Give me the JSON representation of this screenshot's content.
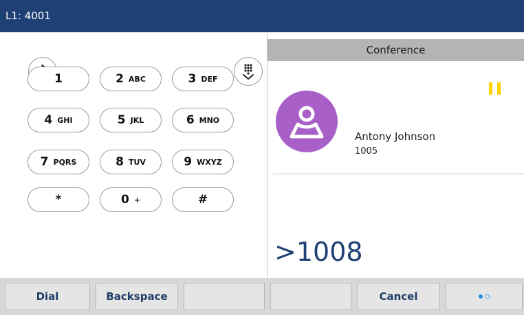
{
  "topbar": {
    "line_label": "L1: 4001"
  },
  "icons": {
    "bluetooth": "bluetooth-icon",
    "dialpad": "dialpad-icon",
    "avatar": "person-icon",
    "hold": "hold-indicator-icon"
  },
  "keypad": {
    "keys": [
      {
        "digit": "1",
        "letters": ""
      },
      {
        "digit": "2",
        "letters": "ABC"
      },
      {
        "digit": "3",
        "letters": "DEF"
      },
      {
        "digit": "4",
        "letters": "GHI"
      },
      {
        "digit": "5",
        "letters": "JKL"
      },
      {
        "digit": "6",
        "letters": "MNO"
      },
      {
        "digit": "7",
        "letters": "PQRS"
      },
      {
        "digit": "8",
        "letters": "TUV"
      },
      {
        "digit": "9",
        "letters": "WXYZ"
      },
      {
        "digit": "*",
        "letters": ""
      },
      {
        "digit": "0",
        "letters": "+"
      },
      {
        "digit": "#",
        "letters": ""
      }
    ]
  },
  "call": {
    "header": "Conference",
    "contact_name": "Antony Johnson",
    "contact_number": "1005",
    "dialed_number": ">1008"
  },
  "softkeys": [
    {
      "label": "Dial"
    },
    {
      "label": "Backspace"
    },
    {
      "label": ""
    },
    {
      "label": ""
    },
    {
      "label": "Cancel"
    }
  ],
  "pager": {
    "pages": 2,
    "current": 1
  },
  "colors": {
    "header_blue": "#1f4074",
    "avatar_purple": "#a85fc8",
    "hold_yellow": "#ffd200",
    "page_dot": "#1e8fe0"
  }
}
